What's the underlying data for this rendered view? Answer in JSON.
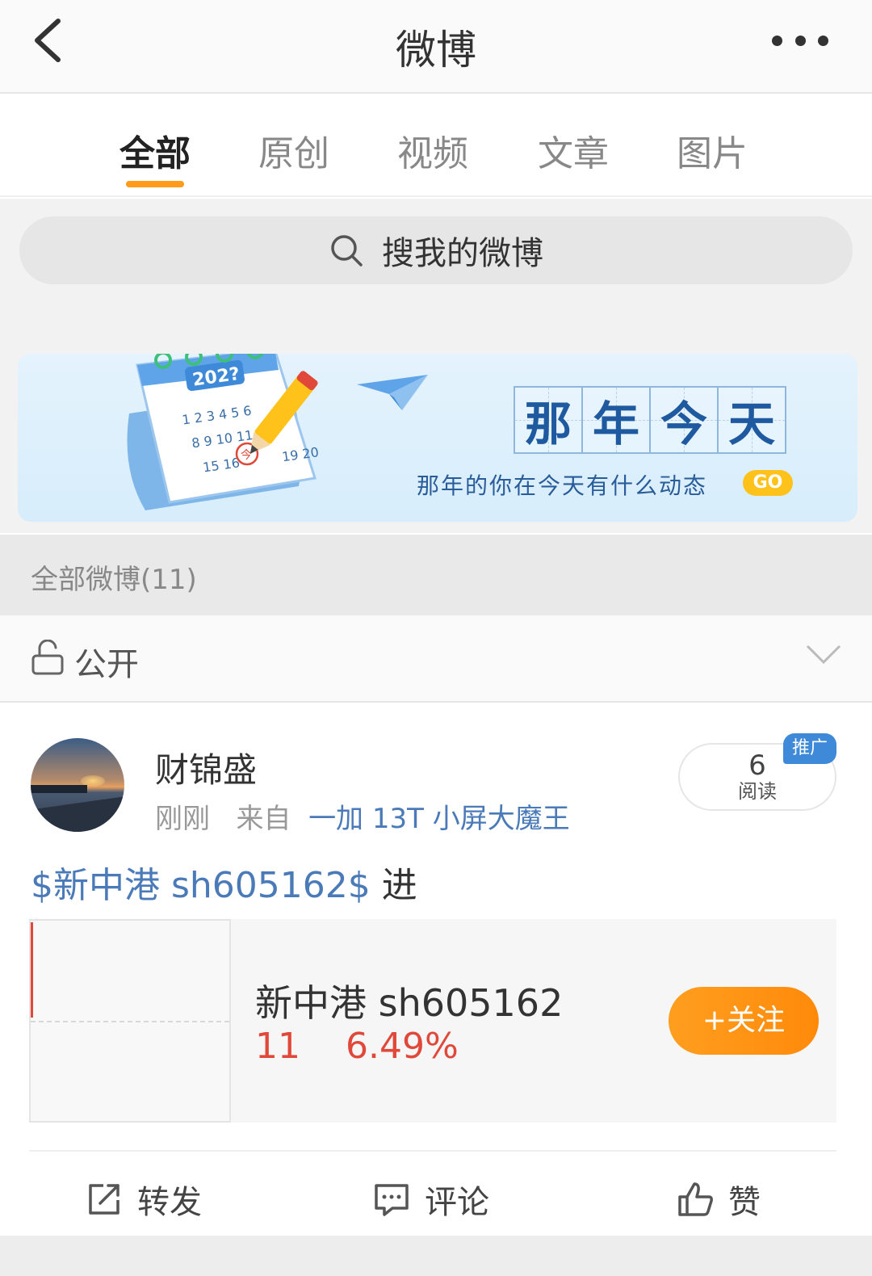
{
  "header": {
    "title": "微博"
  },
  "tabs": [
    {
      "label": "全部",
      "active": true
    },
    {
      "label": "原创",
      "active": false
    },
    {
      "label": "视频",
      "active": false
    },
    {
      "label": "文章",
      "active": false
    },
    {
      "label": "图片",
      "active": false
    }
  ],
  "search": {
    "placeholder": "搜我的微博"
  },
  "banner": {
    "calendar_year": "202?",
    "calendar_rows": [
      "1 2 3 4 5 6",
      "8 9 10 11 12",
      "15 16",
      "19 20"
    ],
    "calendar_stamp": "今",
    "title_chars": [
      "那",
      "年",
      "今",
      "天"
    ],
    "subtitle": "那年的你在今天有什么动态",
    "go_label": "GO"
  },
  "section": {
    "title": "全部微博(11)"
  },
  "visibility": {
    "label": "公开"
  },
  "post": {
    "user_name": "财锦盛",
    "time": "刚刚",
    "source_prefix": "来自",
    "device": "一加 13T 小屏大魔王",
    "read_count": "6",
    "read_label": "阅读",
    "promo_tag": "推广",
    "topic": "$新中港 sh605162$",
    "text": " 进",
    "stock": {
      "name": "新中港 sh605162",
      "price": "11",
      "change": "6.49%",
      "follow_label": "+关注"
    },
    "actions": {
      "repost": "转发",
      "comment": "评论",
      "like": "赞"
    }
  },
  "colors": {
    "accent": "#ff9a1a",
    "link": "#4a7ab8",
    "stock_up": "#e0483a",
    "promo": "#3e8ad8"
  },
  "icons": [
    "back-arrow-icon",
    "more-dots-icon",
    "search-icon",
    "lock-icon",
    "chevron-down-icon",
    "repost-icon",
    "comment-icon",
    "like-icon"
  ]
}
